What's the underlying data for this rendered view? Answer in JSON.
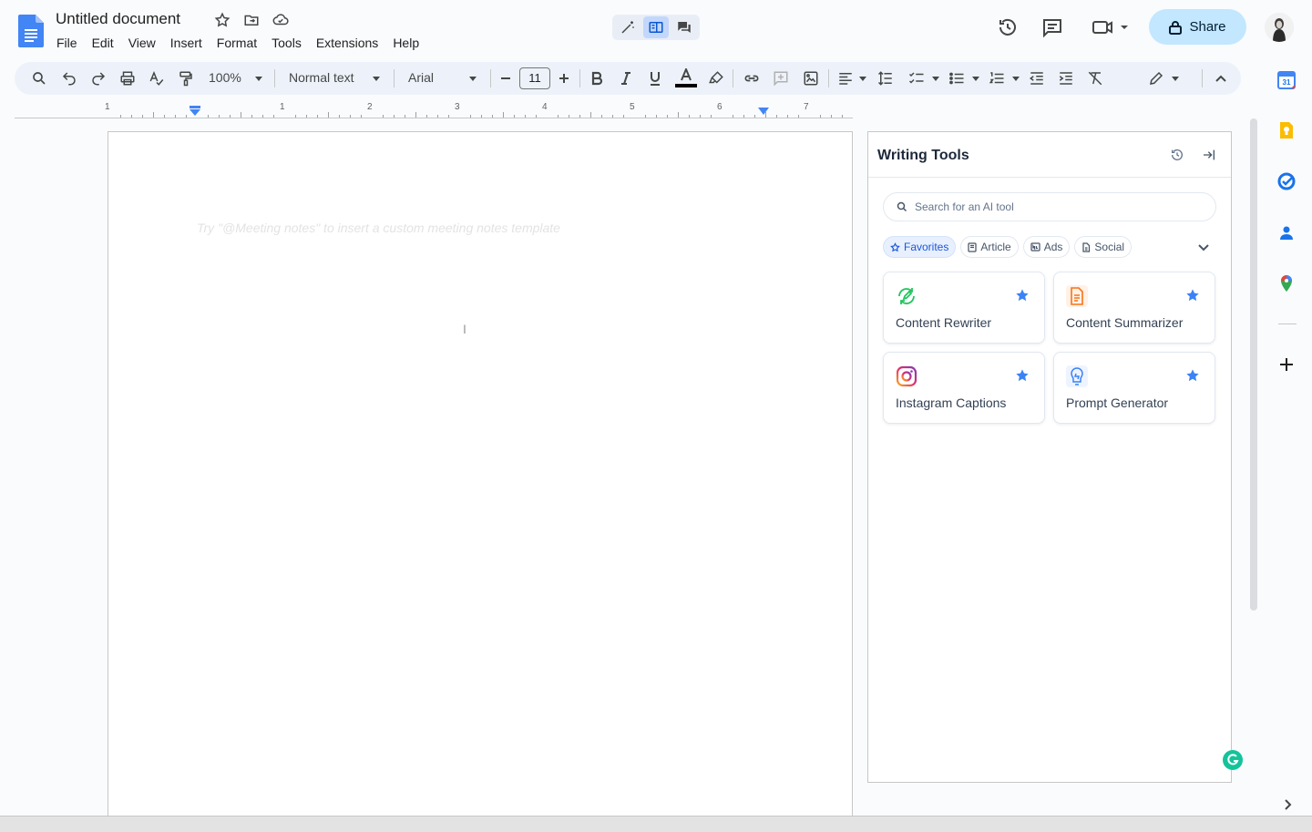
{
  "header": {
    "title": "Untitled document",
    "menu": [
      "File",
      "Edit",
      "View",
      "Insert",
      "Format",
      "Tools",
      "Extensions",
      "Help"
    ],
    "share_label": "Share"
  },
  "toolbar": {
    "zoom": "100%",
    "style": "Normal text",
    "font": "Arial",
    "font_size": "11"
  },
  "ruler": {
    "numbers": [
      "1",
      "1",
      "2",
      "3",
      "4",
      "5",
      "6",
      "7"
    ]
  },
  "document": {
    "placeholder": "Try \"@Meeting notes\" to insert a custom meeting notes template"
  },
  "panel": {
    "title": "Writing Tools",
    "search_placeholder": "Search for an AI tool",
    "chips": [
      "Favorites",
      "Article",
      "Ads",
      "Social"
    ],
    "cards": [
      {
        "label": "Content Rewriter",
        "icon": "rewriter-icon",
        "color": "#22c55e"
      },
      {
        "label": "Content Summarizer",
        "icon": "summarizer-icon",
        "color": "#f97316"
      },
      {
        "label": "Instagram Captions",
        "icon": "instagram-icon",
        "color": "#e1306c"
      },
      {
        "label": "Prompt Generator",
        "icon": "prompt-icon",
        "color": "#3b82f6"
      }
    ]
  },
  "colors": {
    "accent": "#0b57d0",
    "share_bg": "#c2e7ff",
    "star": "#3b82f6"
  }
}
